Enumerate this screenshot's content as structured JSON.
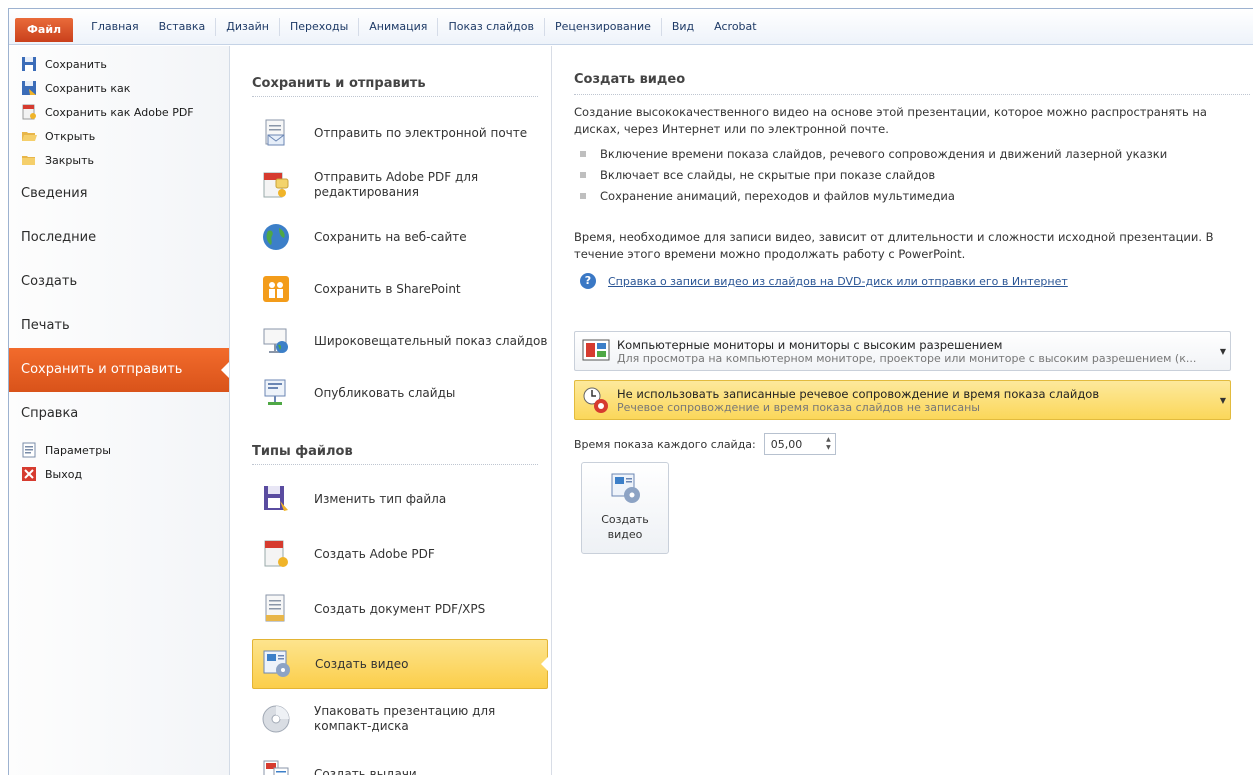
{
  "ribbon": {
    "tabs": [
      "Файл",
      "Главная",
      "Вставка",
      "Дизайн",
      "Переходы",
      "Анимация",
      "Показ слайдов",
      "Рецензирование",
      "Вид",
      "Acrobat"
    ]
  },
  "leftnav": {
    "top_items": [
      {
        "label": "Сохранить",
        "icon": "save-icon"
      },
      {
        "label": "Сохранить как",
        "icon": "save-as-icon"
      },
      {
        "label": "Сохранить как Adobe PDF",
        "icon": "pdf-save-icon"
      },
      {
        "label": "Открыть",
        "icon": "folder-open-icon"
      },
      {
        "label": "Закрыть",
        "icon": "folder-close-icon"
      }
    ],
    "sections": [
      "Сведения",
      "Последние",
      "Создать",
      "Печать",
      "Сохранить и отправить",
      "Справка"
    ],
    "bottom_items": [
      {
        "label": "Параметры",
        "icon": "options-icon"
      },
      {
        "label": "Выход",
        "icon": "exit-icon"
      }
    ]
  },
  "middle": {
    "send_heading": "Сохранить и отправить",
    "send_items": [
      {
        "label": "Отправить по электронной почте",
        "icon": "email-icon"
      },
      {
        "label": "Отправить Adobe PDF для редактирования",
        "icon": "pdf-send-icon"
      },
      {
        "label": "Сохранить на веб-сайте",
        "icon": "globe-icon"
      },
      {
        "label": "Сохранить в SharePoint",
        "icon": "sharepoint-icon"
      },
      {
        "label": "Широковещательный показ слайдов",
        "icon": "broadcast-icon"
      },
      {
        "label": "Опубликовать слайды",
        "icon": "publish-slides-icon"
      }
    ],
    "types_heading": "Типы файлов",
    "type_items": [
      {
        "label": "Изменить тип файла",
        "icon": "change-type-icon"
      },
      {
        "label": "Создать Adobe PDF",
        "icon": "create-pdf-icon"
      },
      {
        "label": "Создать документ PDF/XPS",
        "icon": "pdf-xps-icon"
      },
      {
        "label": "Создать видео",
        "icon": "create-video-icon"
      },
      {
        "label": "Упаковать презентацию для компакт-диска",
        "icon": "cd-package-icon"
      },
      {
        "label": "Создать выдачи",
        "icon": "handouts-icon"
      }
    ]
  },
  "right": {
    "title": "Создать видео",
    "description": "Создание высококачественного видео на основе этой презентации, которое можно распространять на дисках, через Интернет или по электронной почте.",
    "bullets": [
      "Включение времени показа слайдов, речевого сопровождения и движений лазерной указки",
      "Включает все слайды, не скрытые при показе слайдов",
      "Сохранение анимаций, переходов и файлов мультимедиа"
    ],
    "note": "Время, необходимое для записи видео, зависит от длительности и сложности исходной презентации. В течение этого времени можно продолжать работу с PowerPoint.",
    "help_link": "Справка о записи видео из слайдов на DVD-диск или отправки его в Интернет",
    "dropdown_quality": {
      "title": "Компьютерные мониторы и мониторы с высоким разрешением",
      "subtitle": "Для просмотра на компьютерном мониторе, проекторе или мониторе с высоким разрешением (к..."
    },
    "dropdown_narration": {
      "title": "Не использовать записанные речевое сопровождение и время показа слайдов",
      "subtitle": "Речевое сопровождение и время показа слайдов не записаны"
    },
    "timing_label": "Время показа каждого слайда:",
    "timing_value": "05,00",
    "create_button": "Создать видео"
  },
  "colors": {
    "file_tab": "#c9401c",
    "active_nav": "#e85e22",
    "selected_item": "#fbce4a",
    "link": "#2a5595"
  }
}
